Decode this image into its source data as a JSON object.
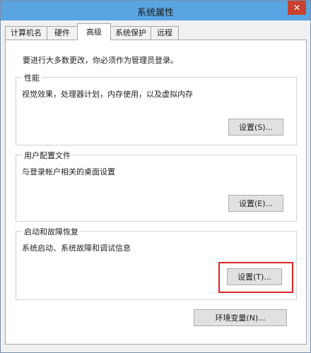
{
  "window": {
    "title": "系统属性",
    "close_symbol": "✕"
  },
  "tabs": [
    {
      "label": "计算机名",
      "active": false
    },
    {
      "label": "硬件",
      "active": false
    },
    {
      "label": "高级",
      "active": true
    },
    {
      "label": "系统保护",
      "active": false
    },
    {
      "label": "远程",
      "active": false
    }
  ],
  "content": {
    "admin_note": "要进行大多数更改，你必须作为管理员登录。",
    "performance": {
      "title": "性能",
      "description": "视觉效果，处理器计划，内存使用，以及虚拟内存",
      "button": "设置(S)..."
    },
    "user_profiles": {
      "title": "用户配置文件",
      "description": "与登录帐户相关的桌面设置",
      "button": "设置(E)..."
    },
    "startup_recovery": {
      "title": "启动和故障恢复",
      "description": "系统启动、系统故障和调试信息",
      "button": "设置(T)..."
    },
    "env_button": "环境变量(N)..."
  },
  "colors": {
    "titlebar": "#5aa4e1",
    "close": "#c7432f",
    "highlight": "#d8262a"
  }
}
